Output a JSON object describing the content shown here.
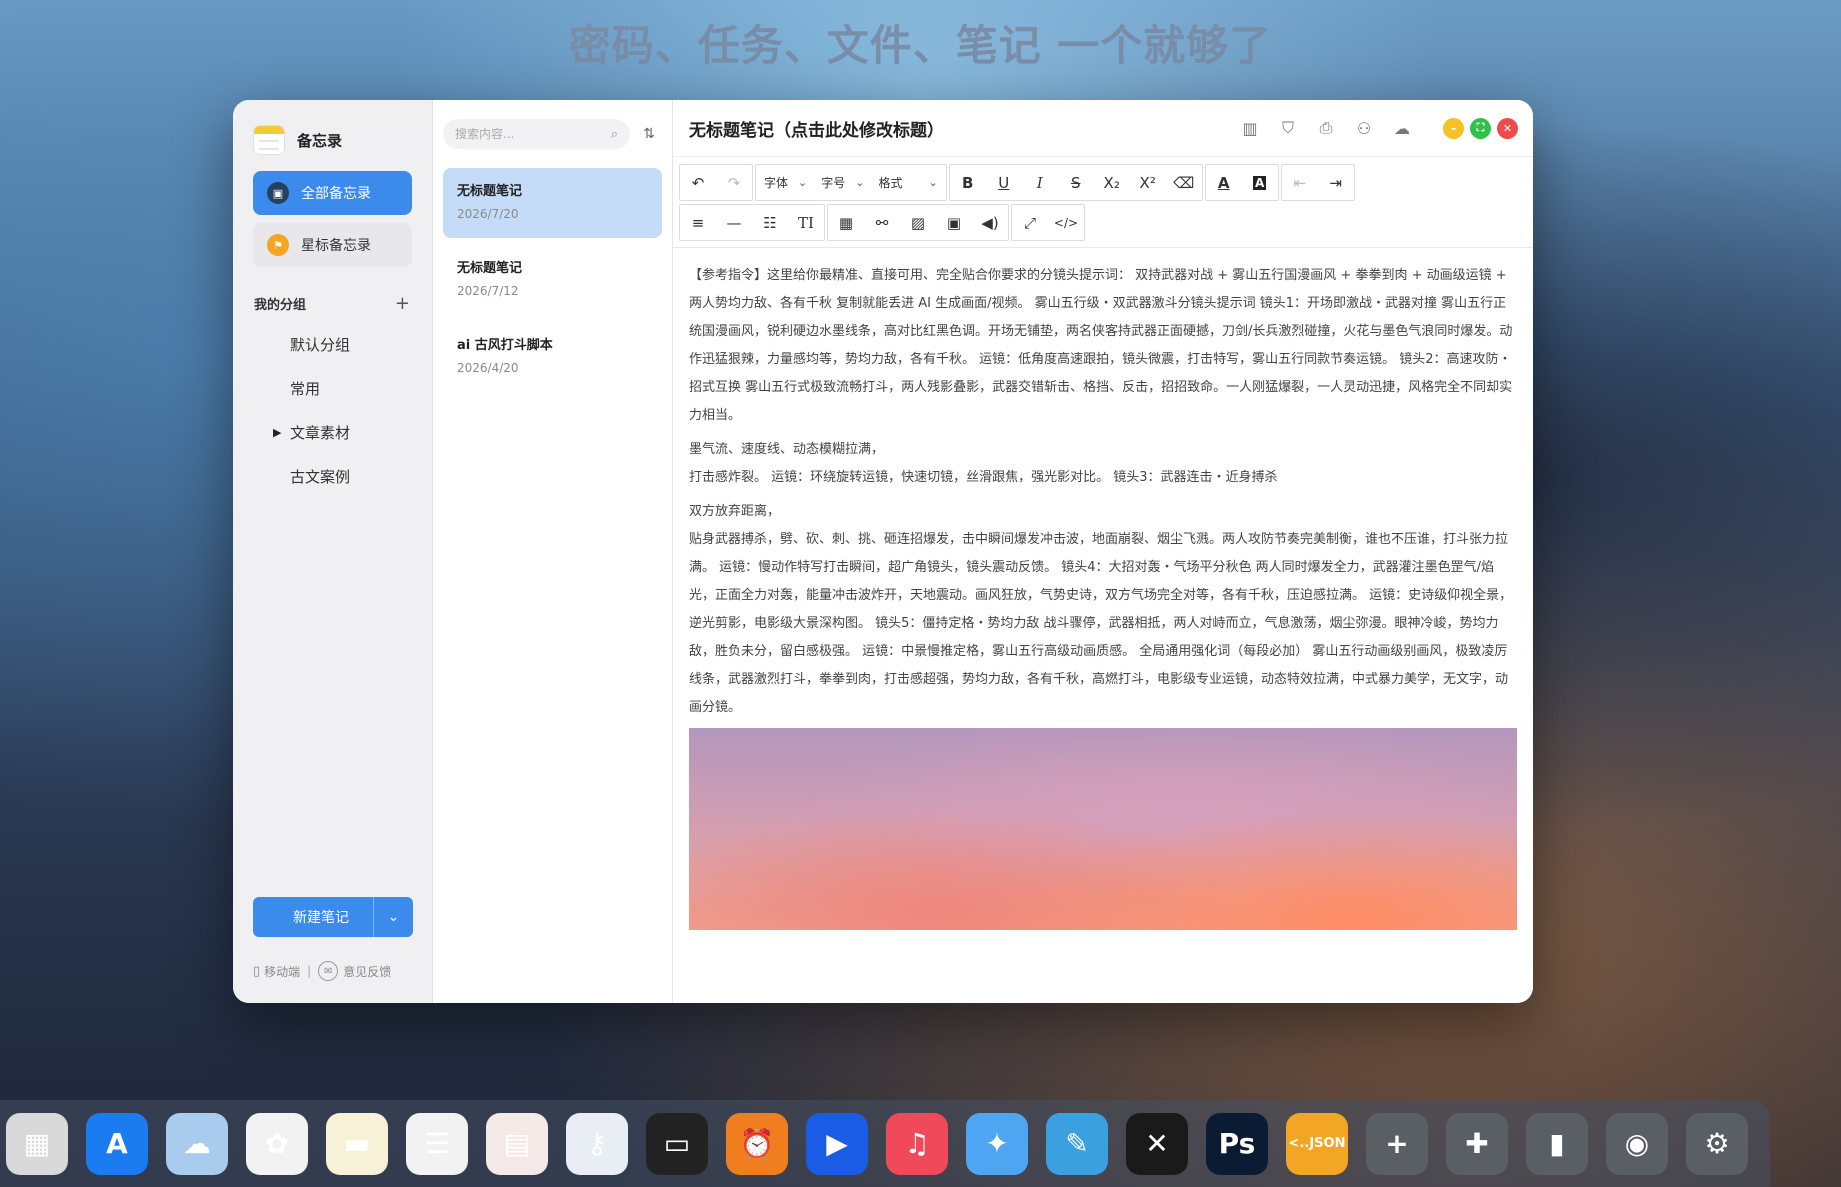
{
  "headline": "密码、任务、文件、笔记 一个就够了",
  "sidebar": {
    "app_name": "备忘录",
    "all_notes": "全部备忘录",
    "starred": "星标备忘录",
    "groups_title": "我的分组",
    "groups_add": "+",
    "groups": [
      "默认分组",
      "常用",
      "文章素材",
      "古文案例"
    ],
    "new_note": "新建笔记",
    "footer_mobile": "移动端",
    "footer_sep": "|",
    "footer_feedback": "意见反馈"
  },
  "notelist": {
    "search_placeholder": "搜索内容...",
    "notes": [
      {
        "title": "无标题笔记",
        "date": "2026/7/20"
      },
      {
        "title": "无标题笔记",
        "date": "2026/7/12"
      },
      {
        "title": "ai 古风打斗脚本",
        "date": "2026/4/20"
      }
    ]
  },
  "editor": {
    "title": "无标题笔记（点击此处修改标题）",
    "toolbar": {
      "font": "字体",
      "size": "字号",
      "format": "格式"
    },
    "paragraphs": [
      "【参考指令】这里给你最精准、直接可用、完全贴合你要求的分镜头提示词： 双持武器对战 + 雾山五行国漫画风 + 拳拳到肉 + 动画级运镜 + 两人势均力敌、各有千秋 复制就能丢进 AI 生成画面/视频。 雾山五行级・双武器激斗分镜头提示词 镜头1：开场即激战・武器对撞 雾山五行正统国漫画风，锐利硬边水墨线条，高对比红黑色调。开场无铺垫，两名侠客持武器正面硬撼，刀剑/长兵激烈碰撞，火花与墨色气浪同时爆发。动作迅猛狠辣，力量感均等，势均力敌，各有千秋。 运镜：低角度高速跟拍，镜头微震，打击特写，雾山五行同款节奏运镜。 镜头2：高速攻防・招式互换 雾山五行式极致流畅打斗，两人残影叠影，武器交错斩击、格挡、反击，招招致命。一人刚猛爆裂，一人灵动迅捷，风格完全不同却实力相当。",
      "墨气流、速度线、动态模糊拉满，\n打击感炸裂。 运镜：环绕旋转运镜，快速切镜，丝滑跟焦，强光影对比。 镜头3：武器连击・近身搏杀",
      "双方放弃距离，\n贴身武器搏杀，劈、砍、刺、挑、砸连招爆发，击中瞬间爆发冲击波，地面崩裂、烟尘飞溅。两人攻防节奏完美制衡，谁也不压谁，打斗张力拉满。 运镜：慢动作特写打击瞬间，超广角镜头，镜头震动反馈。 镜头4：大招对轰・气场平分秋色 两人同时爆发全力，武器灌注墨色罡气/焰光，正面全力对轰，能量冲击波炸开，天地震动。画风狂放，气势史诗，双方气场完全对等，各有千秋，压迫感拉满。 运镜：史诗级仰视全景，逆光剪影，电影级大景深构图。 镜头5：僵持定格・势均力敌 战斗骤停，武器相抵，两人对峙而立，气息激荡，烟尘弥漫。眼神冷峻，势均力敌，胜负未分，留白感极强。 运镜：中景慢推定格，雾山五行高级动画质感。 全局通用强化词（每段必加） 雾山五行动画级别画风，极致凌厉线条，武器激烈打斗，拳拳到肉，打击感超强，势均力敌，各有千秋，高燃打斗，电影级专业运镜，动态特效拉满，中式暴力美学，无文字，动画分镜。"
    ]
  },
  "colors": {
    "accent": "#3b8bec",
    "selected_note": "#c5dcf8",
    "star": "#f5a524",
    "traffic_min": "#f5c124",
    "traffic_max": "#2ec24b",
    "traffic_close": "#ef4b4b"
  },
  "dock": [
    {
      "name": "launchpad-icon",
      "bg": "#d9d9d9",
      "glyph": "▦"
    },
    {
      "name": "app-store-icon",
      "bg": "#1a7cf0",
      "glyph": "A"
    },
    {
      "name": "icloud-icon",
      "bg": "#a8cbee",
      "glyph": "☁"
    },
    {
      "name": "photos-icon",
      "bg": "#f2f2f2",
      "glyph": "✿"
    },
    {
      "name": "notes-icon",
      "bg": "#f7f1d8",
      "glyph": "▬"
    },
    {
      "name": "reminders-icon",
      "bg": "#f2f2f2",
      "glyph": "☰"
    },
    {
      "name": "calendar-icon",
      "bg": "#f4e9e6",
      "glyph": "▤"
    },
    {
      "name": "passwords-icon",
      "bg": "#e8eef4",
      "glyph": "⚷"
    },
    {
      "name": "wallet-icon",
      "bg": "#222222",
      "glyph": "▭"
    },
    {
      "name": "clock-icon",
      "bg": "#f07d1e",
      "glyph": "⏰"
    },
    {
      "name": "play-icon",
      "bg": "#1a5ce5",
      "glyph": "▶"
    },
    {
      "name": "music-icon",
      "bg": "#f04a5a",
      "glyph": "♫"
    },
    {
      "name": "safari-icon",
      "bg": "#4ea6f2",
      "glyph": "✦"
    },
    {
      "name": "freeform-icon",
      "bg": "#3aa0e0",
      "glyph": "✎"
    },
    {
      "name": "capcut-icon",
      "bg": "#1a1a1a",
      "glyph": "✕"
    },
    {
      "name": "photoshop-icon",
      "bg": "#0c1b34",
      "glyph": "Ps"
    },
    {
      "name": "json-icon",
      "bg": "#f2a623",
      "glyph": "<..JSON"
    },
    {
      "name": "add-icon",
      "bg": "#5a5f66",
      "glyph": "+"
    },
    {
      "name": "puzzle-icon",
      "bg": "#5a5f66",
      "glyph": "✚"
    },
    {
      "name": "brush-icon",
      "bg": "#5a5f66",
      "glyph": "▮"
    },
    {
      "name": "lock-icon",
      "bg": "#5a5f66",
      "glyph": "◉"
    },
    {
      "name": "settings-icon",
      "bg": "#5a5f66",
      "glyph": "⚙"
    }
  ]
}
